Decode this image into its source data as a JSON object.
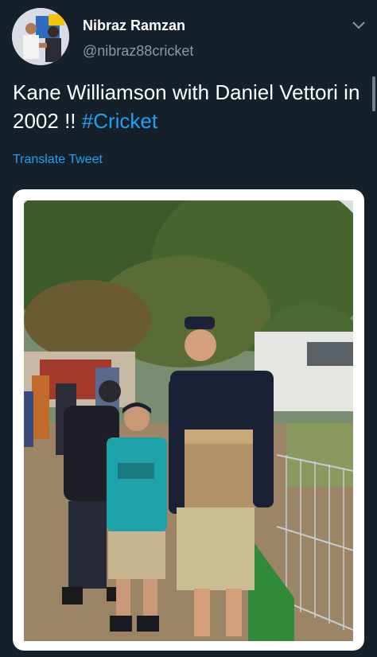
{
  "author": {
    "display_name": "Nibraz Ramzan",
    "handle": "@nibraz88cricket",
    "avatar_icon": "profile-photo"
  },
  "tweet": {
    "text": "Kane Williamson with Daniel Vettori in 2002 !! ",
    "hashtag": "#Cricket"
  },
  "translate_label": "Translate Tweet",
  "menu_icon": "chevron-down-icon",
  "colors": {
    "background": "#15202b",
    "accent": "#1da1f2",
    "secondary_text": "#8899a6"
  }
}
